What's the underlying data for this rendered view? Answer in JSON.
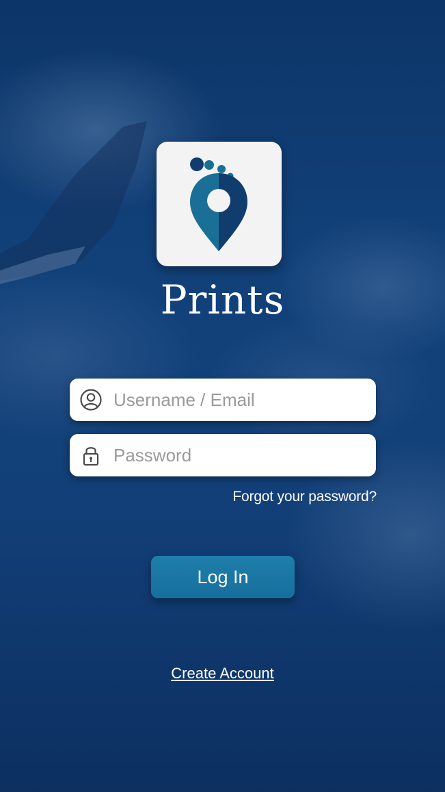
{
  "app": {
    "title": "Prints"
  },
  "login_form": {
    "username": {
      "placeholder": "Username / Email",
      "value": ""
    },
    "password": {
      "placeholder": "Password",
      "value": ""
    },
    "forgot_password_label": "Forgot your password?",
    "login_button_label": "Log In",
    "create_account_label": "Create Account"
  },
  "icons": {
    "logo": "footprint-location-pin-icon",
    "username": "user-circle-icon",
    "password": "padlock-icon"
  },
  "colors": {
    "background": "#12417a",
    "logo_card": "#f3f3f4",
    "logo_teal": "#1a6f97",
    "logo_navy": "#103d6e",
    "button": "#1a76a3",
    "text_light": "#ffffff",
    "placeholder": "#9a9a9a"
  }
}
